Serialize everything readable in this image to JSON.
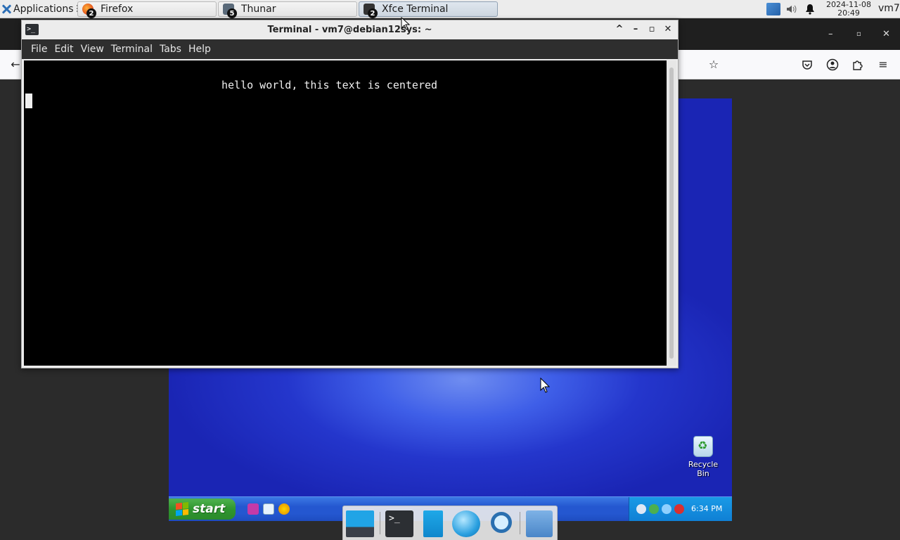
{
  "top_panel": {
    "applications_label": "Applications",
    "tasks": [
      {
        "label": "Firefox",
        "count": "2"
      },
      {
        "label": "Thunar",
        "count": "5"
      },
      {
        "label": "Xfce Terminal",
        "count": "2"
      }
    ],
    "clock_date": "2024-11-08",
    "clock_time": "20:49",
    "user": "vm7"
  },
  "terminal": {
    "title": "Terminal - vm7@debian12sys: ~",
    "menu": [
      "File",
      "Edit",
      "View",
      "Terminal",
      "Tabs",
      "Help"
    ],
    "output_line": "hello world, this text is centered"
  },
  "xp_desktop": {
    "recycle_bin_label": "Recycle Bin",
    "start_label": "start",
    "tray_time": "6:34 PM"
  },
  "icons": {
    "firefox_toolbar": [
      "back-arrow-icon",
      "bookmark-star-icon",
      "pocket-icon",
      "account-icon",
      "extensions-icon",
      "menu-icon"
    ],
    "dock": [
      "show-desktop-icon",
      "terminal-icon",
      "file-manager-icon",
      "web-browser-icon",
      "app-finder-icon",
      "home-folder-icon"
    ]
  }
}
